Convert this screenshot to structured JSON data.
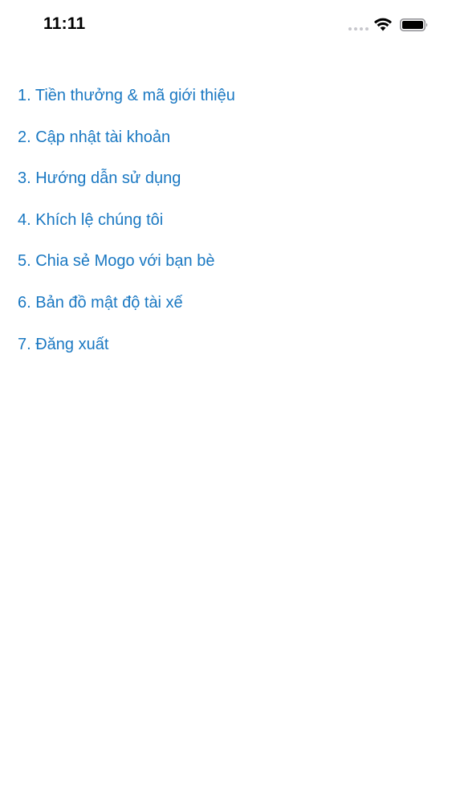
{
  "status_bar": {
    "time": "11:11",
    "icons": [
      "cellular-signal-icon",
      "wifi-icon",
      "battery-icon"
    ]
  },
  "menu": {
    "accent_color": "#1a78c2",
    "items": [
      {
        "label": "1. Tiền thưởng & mã giới thiệu"
      },
      {
        "label": "2. Cập nhật tài khoản"
      },
      {
        "label": "3. Hướng dẫn sử dụng"
      },
      {
        "label": "4. Khích lệ chúng tôi"
      },
      {
        "label": "5. Chia sẻ Mogo với bạn bè"
      },
      {
        "label": "6. Bản đồ mật độ tài xế"
      },
      {
        "label": "7. Đăng xuất"
      }
    ]
  }
}
